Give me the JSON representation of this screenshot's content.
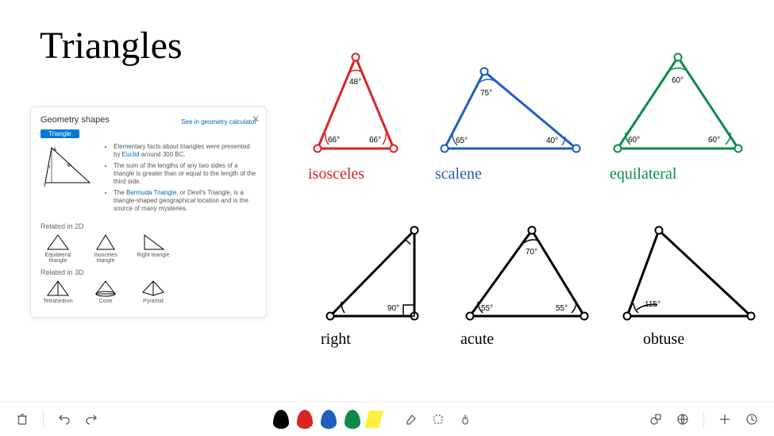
{
  "title": "Triangles",
  "card": {
    "heading": "Geometry shapes",
    "pill": "Triangle",
    "link": "See in geometry calculator",
    "facts": [
      "Elementary facts about triangles were presented by <a>Euclid</a> around 300 BC.",
      "The sum of the lengths of any two sides of a triangle is greater than or equal to the length of the third side.",
      "The <a>Bermuda Triangle</a>, or Devil's Triangle, is a triangle-shaped geographical location and is the source of many mysteries."
    ],
    "related2d_label": "Related in 2D",
    "related2d": [
      "Equilateral triangle",
      "Isosceles triangle",
      "Right triangle"
    ],
    "related3d_label": "Related in 3D",
    "related3d": [
      "Tetrahedron",
      "Cone",
      "Pyramid"
    ]
  },
  "triangles": {
    "isosceles": {
      "label": "isosceles",
      "angles": {
        "top": "48°",
        "left": "66°",
        "right": "66°"
      }
    },
    "scalene": {
      "label": "scalene",
      "angles": {
        "top": "75°",
        "left": "65°",
        "right": "40°"
      }
    },
    "equilateral": {
      "label": "equilateral",
      "angles": {
        "top": "60°",
        "left": "60°",
        "right": "60°"
      }
    },
    "right": {
      "label": "right",
      "angles": {
        "right": "90°"
      }
    },
    "acute": {
      "label": "acute",
      "angles": {
        "top": "70°",
        "left": "55°",
        "right": "55°"
      }
    },
    "obtuse": {
      "label": "obtuse",
      "angles": {
        "apex": "115°"
      }
    }
  },
  "chart_data": [
    {
      "type": "diagram",
      "name": "isosceles",
      "color": "red",
      "angles": [
        48,
        66,
        66
      ]
    },
    {
      "type": "diagram",
      "name": "scalene",
      "color": "blue",
      "angles": [
        75,
        65,
        40
      ]
    },
    {
      "type": "diagram",
      "name": "equilateral",
      "color": "green",
      "angles": [
        60,
        60,
        60
      ]
    },
    {
      "type": "diagram",
      "name": "right",
      "color": "black",
      "angles": [
        90
      ]
    },
    {
      "type": "diagram",
      "name": "acute",
      "color": "black",
      "angles": [
        70,
        55,
        55
      ]
    },
    {
      "type": "diagram",
      "name": "obtuse",
      "color": "black",
      "angles": [
        115
      ]
    }
  ],
  "pens": {
    "black": "#000",
    "red": "#d92424",
    "blue": "#1f5fbf",
    "green": "#0f8a4b",
    "highlighter": "#ffef3e"
  }
}
